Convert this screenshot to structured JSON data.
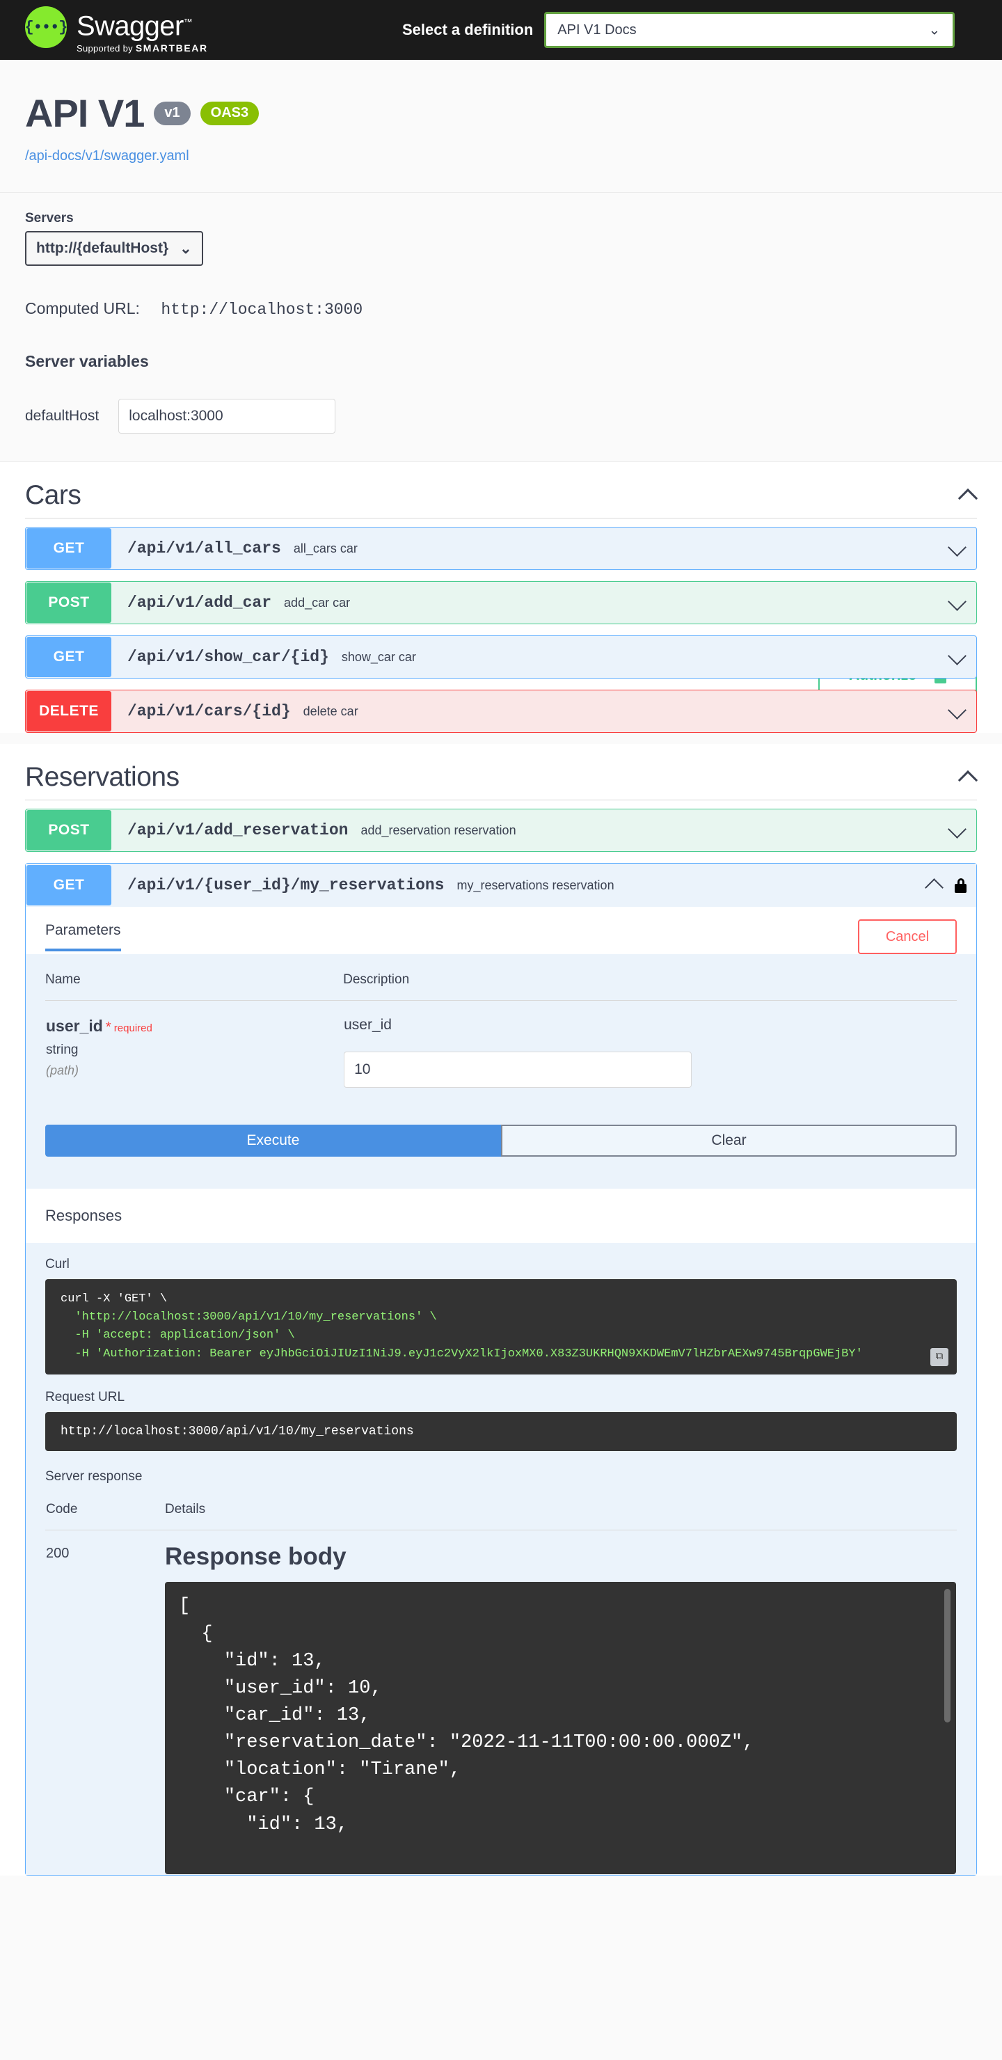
{
  "topbar": {
    "logo_glyph": "{•••}",
    "logo_title": "Swagger",
    "logo_tm": "™",
    "logo_supported_prefix": "Supported by ",
    "logo_brand": "SMARTBEAR",
    "select_definition_label": "Select a definition",
    "definition_value": "API V1 Docs",
    "chevron": "⌄"
  },
  "info": {
    "title": "API V1",
    "version_badge": "v1",
    "oas_badge": "OAS3",
    "spec_link": "/api-docs/v1/swagger.yaml"
  },
  "servers": {
    "label": "Servers",
    "selected": "http://{defaultHost}",
    "chevron": "⌄",
    "computed_url_label": "Computed URL:",
    "computed_url_value": "http://localhost:3000",
    "variables_title": "Server variables",
    "variable_name": "defaultHost",
    "variable_value": "localhost:3000",
    "authorize_label": "Authorize"
  },
  "tags": [
    {
      "name": "Cars",
      "collapse_icon": "chevron-up",
      "operations": [
        {
          "method": "GET",
          "path": "/api/v1/all_cars",
          "summary": "all_cars car",
          "style": "get",
          "expanded": false
        },
        {
          "method": "POST",
          "path": "/api/v1/add_car",
          "summary": "add_car car",
          "style": "post",
          "expanded": false
        },
        {
          "method": "GET",
          "path": "/api/v1/show_car/{id}",
          "summary": "show_car car",
          "style": "get",
          "expanded": false
        },
        {
          "method": "DELETE",
          "path": "/api/v1/cars/{id}",
          "summary": "delete car",
          "style": "delete",
          "expanded": false
        }
      ]
    },
    {
      "name": "Reservations",
      "collapse_icon": "chevron-up",
      "operations": [
        {
          "method": "POST",
          "path": "/api/v1/add_reservation",
          "summary": "add_reservation reservation",
          "style": "post",
          "expanded": false
        },
        {
          "method": "GET",
          "path": "/api/v1/{user_id}/my_reservations",
          "summary": "my_reservations reservation",
          "style": "get",
          "expanded": true,
          "secured": true
        }
      ]
    }
  ],
  "expanded_op": {
    "tab_label": "Parameters",
    "cancel_label": "Cancel",
    "table_headers": {
      "name": "Name",
      "description": "Description"
    },
    "parameter": {
      "name": "user_id",
      "required_star": "*",
      "required_label": "required",
      "type": "string",
      "location": "(path)",
      "description": "user_id",
      "value": "10"
    },
    "execute_label": "Execute",
    "clear_label": "Clear",
    "responses_label": "Responses",
    "curl_label": "Curl",
    "curl_lines": [
      "curl -X 'GET' \\",
      "  'http://localhost:3000/api/v1/10/my_reservations' \\",
      "  -H 'accept: application/json' \\",
      "  -H 'Authorization: Bearer eyJhbGciOiJIUzI1NiJ9.eyJ1c2VyX2lkIjoxMX0.X83Z3UKRHQN9XKDWEmV7lHZbrAEXw9745BrqpGWEjBY'"
    ],
    "copy_icon": "copy-icon",
    "request_url_label": "Request URL",
    "request_url_value": "http://localhost:3000/api/v1/10/my_reservations",
    "server_response_label": "Server response",
    "code_headers": {
      "code": "Code",
      "details": "Details"
    },
    "response_code": "200",
    "response_body_title": "Response body",
    "response_body": "[\n  {\n    \"id\": 13,\n    \"user_id\": 10,\n    \"car_id\": 13,\n    \"reservation_date\": \"2022-11-11T00:00:00.000Z\",\n    \"location\": \"Tirane\",\n    \"car\": {\n      \"id\": 13,"
  },
  "colors": {
    "brand_green": "#85ea2d",
    "get_blue": "#61affe",
    "post_green": "#49cc90",
    "delete_red": "#f93e3e",
    "execute_blue": "#4990e2",
    "cancel_red": "#ff6060",
    "dark_bg": "#1b1b1b",
    "code_bg": "#333333"
  }
}
